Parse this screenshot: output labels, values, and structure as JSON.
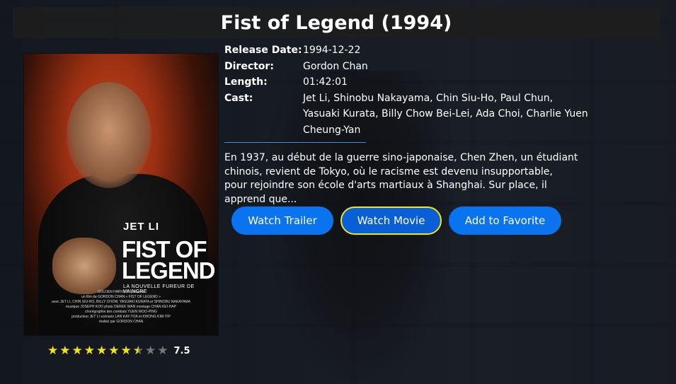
{
  "movie": {
    "title": "Fist of Legend (1994)",
    "details": [
      {
        "label": "Release Date:",
        "value": "1994-12-22"
      },
      {
        "label": "Director:",
        "value": "Gordon Chan"
      },
      {
        "label": "Length:",
        "value": "01:42:01"
      },
      {
        "label": "Cast:",
        "value": "Jet Li, Shinobu Nakayama, Chin Siu-Ho, Paul Chun, Yasuaki Kurata, Billy Chow Bei-Lei, Ada Choi, Charlie Yuen Cheung-Yan"
      }
    ],
    "synopsis": "En 1937, au début de la guerre sino-japonaise, Chen Zhen, un étudiant chinois, revient de Tokyo, où le racisme est devenu insupportable, pour rejoindre son école d'arts martiaux à Shanghai. Sur place, il apprend que...",
    "rating_value": "7.5",
    "rating_stars": 7.5,
    "rating_max": 10
  },
  "poster": {
    "actor": "JET LI",
    "title_line1": "FIST OF",
    "title_line2": "LEGEND",
    "subtitle": "LA NOUVELLE FUREUR DE VAINCRE",
    "credits": [
      "GOLDEN HARVEST présente",
      "un film de GORDON CHAN « FIST OF LEGEND »",
      "avec JET LI, CHIN SIU-HO, BILLY CHOW, YASUAKI KURATA et SHINOBU NAKAYAMA",
      "musique JOSEPH KOO photo DEREK WAN montage CHAN KEI-HAP",
      "chorégraphie des combats YUEN WOO-PING",
      "producteur JET LI scénario LAN KAY-TOA et KWONG KIM-YIP",
      "réalisé par GORDON CHAN"
    ]
  },
  "buttons": {
    "trailer": "Watch Trailer",
    "movie": "Watch Movie",
    "favorite": "Add to Favorite"
  },
  "colors": {
    "button": "#0a73f0",
    "focus_border": "#e8e81a",
    "star": "#f5e21b",
    "divider": "#3a8fd6"
  }
}
